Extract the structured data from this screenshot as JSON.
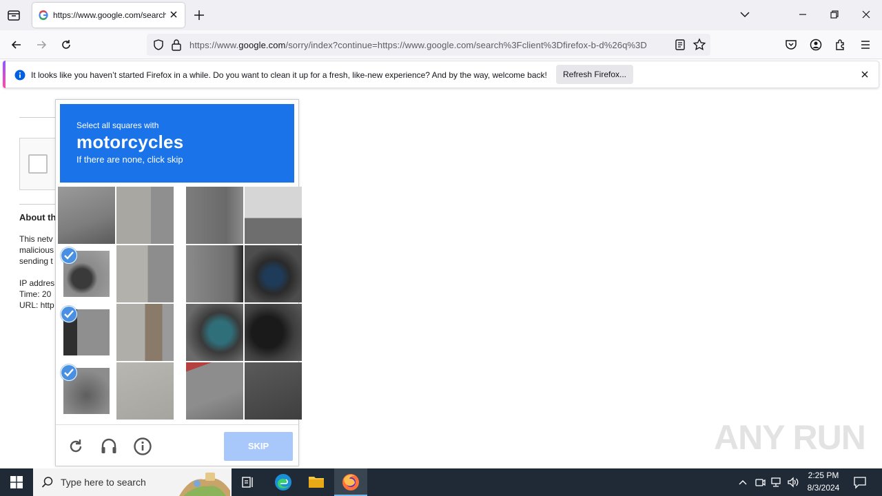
{
  "browser": {
    "tab_title": "https://www.google.com/search",
    "url_prefix": "https://www.",
    "url_domain": "google.com",
    "url_rest": "/sorry/index?continue=https://www.google.com/search%3Fclient%3Dfirefox-b-d%26q%3D",
    "notification_message": "It looks like you haven’t started Firefox in a while. Do you want to clean it up for a fresh, like-new experience? And by the way, welcome back!",
    "notification_button": "Refresh Firefox..."
  },
  "page": {
    "about_heading": "About th",
    "para_lines": [
      "This netv",
      "malicious",
      "sending t"
    ],
    "info_lines": [
      "IP addres",
      "Time: 20",
      "URL: http"
    ]
  },
  "captcha": {
    "instruction_small": "Select all squares with",
    "target": "motorcycles",
    "instruction_hint": "If there are none, click skip",
    "skip_label": "SKIP"
  },
  "taskbar": {
    "search_placeholder": "Type here to search",
    "time": "2:25 PM",
    "date": "8/3/2024"
  },
  "watermark": "ANY RUN",
  "colors": {
    "captcha_header": "#1a73e8",
    "skip_button": "#a8c7fa",
    "check_badge": "#4a90e2"
  }
}
